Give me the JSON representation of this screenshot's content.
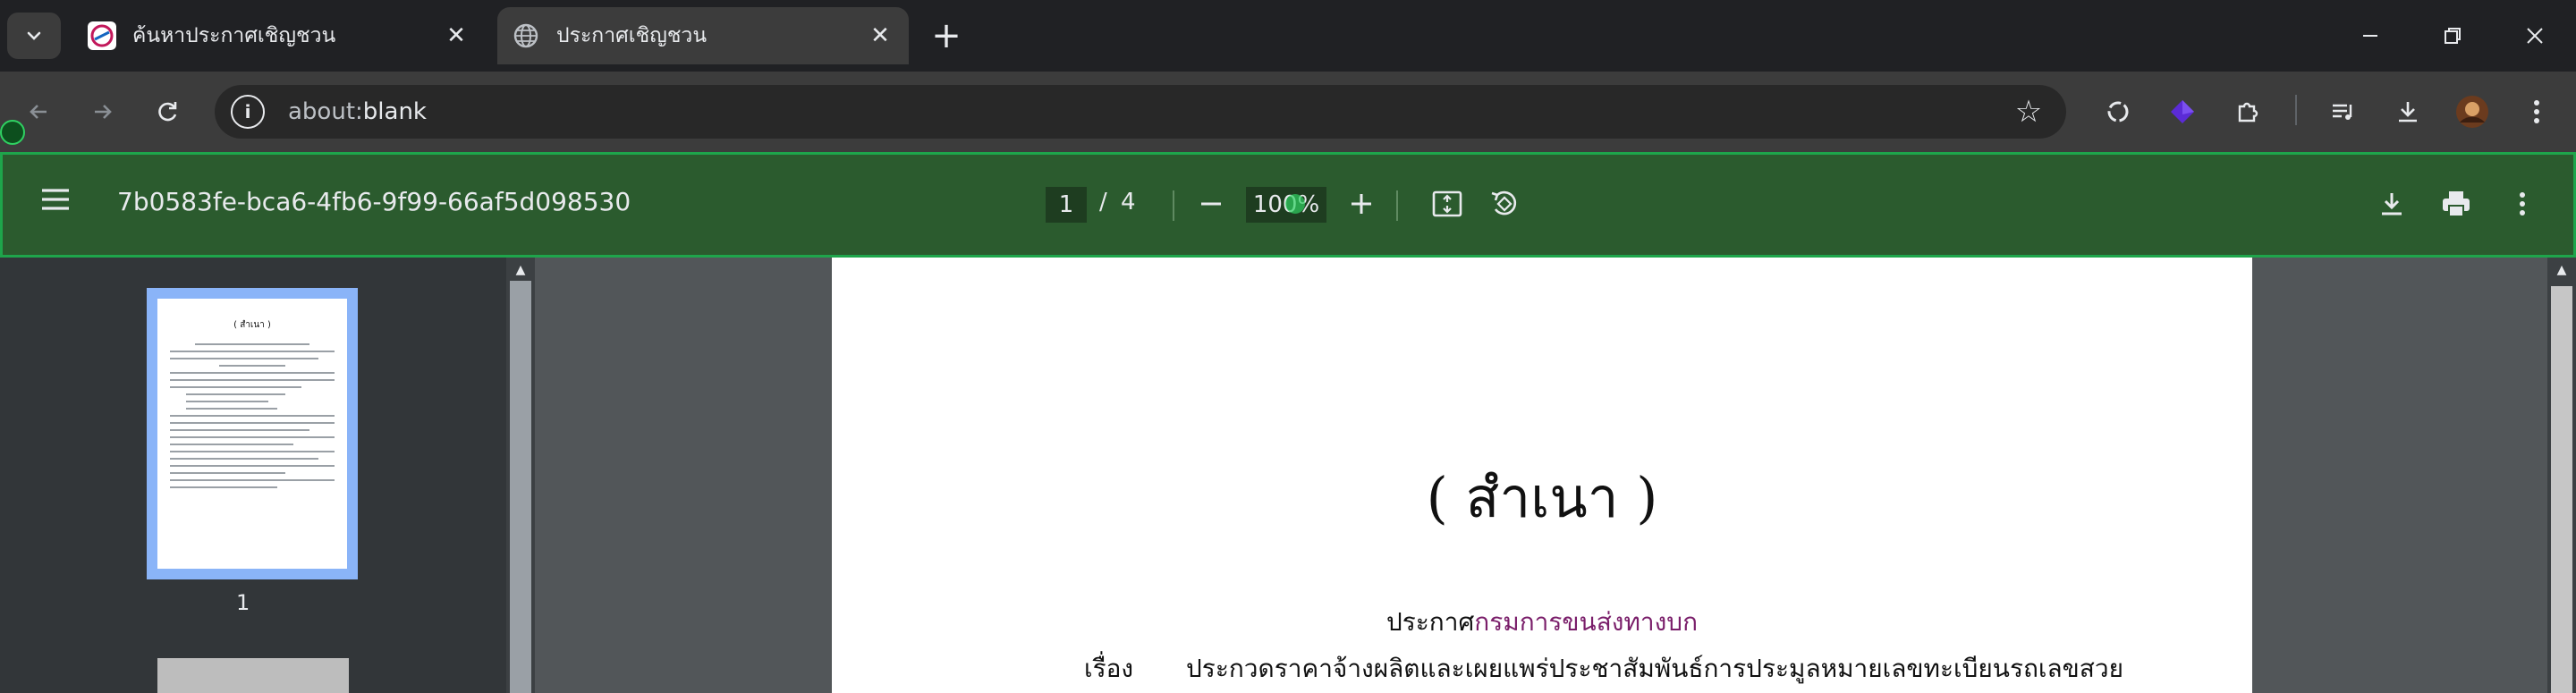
{
  "tabs": [
    {
      "title": "ค้นหาประกาศเชิญชวน",
      "active": false
    },
    {
      "title": "ประกาศเชิญชวน",
      "active": true
    }
  ],
  "omnibox": {
    "scheme": "about:",
    "host": "blank"
  },
  "pdf": {
    "file_name": "7b0583fe-bca6-4fb6-9f99-66af5d098530",
    "current_page": "1",
    "page_separator": "/",
    "total_pages": "4",
    "zoom": "100%"
  },
  "sidebar": {
    "thumbnail_label": "1",
    "thumbnail_title": "( สำเนา )"
  },
  "document": {
    "heading": "( สำเนา )",
    "announce_prefix": "ประกาศ",
    "announce_org": "กรมการขนส่งทางบก",
    "subject_label": "เรื่อง",
    "subject_text": "ประกวดราคาจ้างผลิตและเผยแพร่ประชาสัมพันธ์การประมูลหมายเลขทะเบียนรถเลขสวย"
  },
  "colors": {
    "pdf_toolbar_bg": "#2b5b2e",
    "pdf_toolbar_border": "#1ea54b",
    "thumbnail_selected": "#8ab4f8",
    "org_text": "#7a1e6a"
  }
}
